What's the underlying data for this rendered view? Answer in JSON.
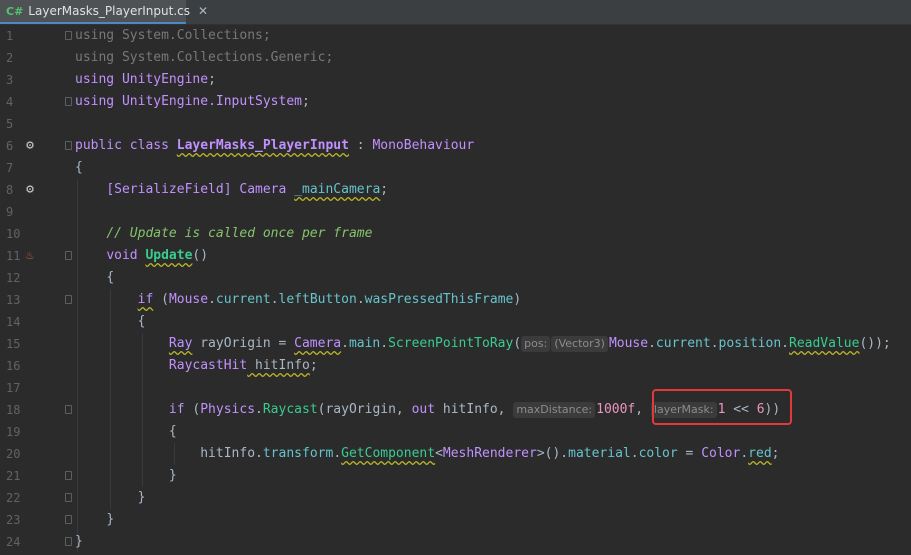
{
  "tab": {
    "lang_badge": "C#",
    "filename": "LayerMasks_PlayerInput.cs",
    "close": "✕"
  },
  "lines": [
    {
      "n": "1"
    },
    {
      "n": "2"
    },
    {
      "n": "3"
    },
    {
      "n": "4"
    },
    {
      "n": "5"
    },
    {
      "n": "6"
    },
    {
      "n": "7"
    },
    {
      "n": "8"
    },
    {
      "n": "9"
    },
    {
      "n": "10"
    },
    {
      "n": "11"
    },
    {
      "n": "12"
    },
    {
      "n": "13"
    },
    {
      "n": "14"
    },
    {
      "n": "15"
    },
    {
      "n": "16"
    },
    {
      "n": "17"
    },
    {
      "n": "18"
    },
    {
      "n": "19"
    },
    {
      "n": "20"
    },
    {
      "n": "21"
    },
    {
      "n": "22"
    },
    {
      "n": "23"
    },
    {
      "n": "24"
    }
  ],
  "code": {
    "l1": {
      "kw": "using",
      "ns": "System.Collections;"
    },
    "l2": {
      "kw": "using",
      "ns": "System.Collections.Generic;"
    },
    "l3": {
      "kw": "using",
      "ns": "UnityEngine",
      "end": ";"
    },
    "l4": {
      "kw": "using",
      "ns": "UnityEngine.InputSystem",
      "end": ";"
    },
    "l6": {
      "kw1": "public",
      "kw2": "class",
      "name": "LayerMasks_PlayerInput",
      "sep": " : ",
      "base": "MonoBehaviour"
    },
    "l7": "{",
    "l8": {
      "attr": "[SerializeField]",
      "type": "Camera",
      "field": "_mainCamera",
      "end": ";"
    },
    "l10": "// Update is called once per frame",
    "l11": {
      "kw": "void",
      "name": "Update",
      "paren": "()"
    },
    "l12": "{",
    "l13": {
      "kw": "if",
      "p1": " (",
      "cls": "Mouse",
      "d1": ".",
      "f1": "current",
      "d2": ".",
      "f2": "leftButton",
      "d3": ".",
      "f3": "wasPressedThisFrame",
      "p2": ")"
    },
    "l14": "{",
    "l15": {
      "type": "Ray",
      "var": " rayOrigin = ",
      "cls": "Camera",
      "d1": ".",
      "f1": "main",
      "d2": ".",
      "m1": "ScreenPointToRay",
      "p1": "(",
      "hint1": "pos:",
      "hint2": "(Vector3)",
      "cls2": "Mouse",
      "d3": ".",
      "f2": "current",
      "d4": ".",
      "f3": "position",
      "d5": ".",
      "m2": "ReadValue",
      "end": "());"
    },
    "l16": {
      "type": "RaycastHit",
      "var": " hitInfo",
      "end": ";"
    },
    "l18": {
      "kw": "if",
      "p1": " (",
      "cls": "Physics",
      "d1": ".",
      "m1": "Raycast",
      "args1": "(rayOrigin, ",
      "kw2": "out",
      "args2": " hitInfo, ",
      "hint1": "maxDistance:",
      "num1": "1000f",
      "comma": ", ",
      "hint2": "layerMask:",
      "num2": "1",
      "op": " << ",
      "num3": "6",
      "end": "))"
    },
    "l19": "{",
    "l20": {
      "var": "hitInfo",
      "d1": ".",
      "f1": "transform",
      "d2": ".",
      "m1": "GetComponent",
      "lt": "<",
      "type": "MeshRenderer",
      "gt": ">",
      "p": "()",
      "d3": ".",
      "f2": "material",
      "d4": ".",
      "f3": "color",
      "eq": " = ",
      "cls": "Color",
      "d5": ".",
      "f4": "red",
      "end": ";"
    },
    "l21": "}",
    "l22": "}",
    "l23": "}",
    "l24": "}"
  },
  "gutter_icons": {
    "l6": "unity-icon",
    "l8": "unity-icon",
    "l11": "hot-method-icon"
  },
  "colors": {
    "highlight_box": "#e03a3a",
    "background": "#2b2b2b"
  }
}
